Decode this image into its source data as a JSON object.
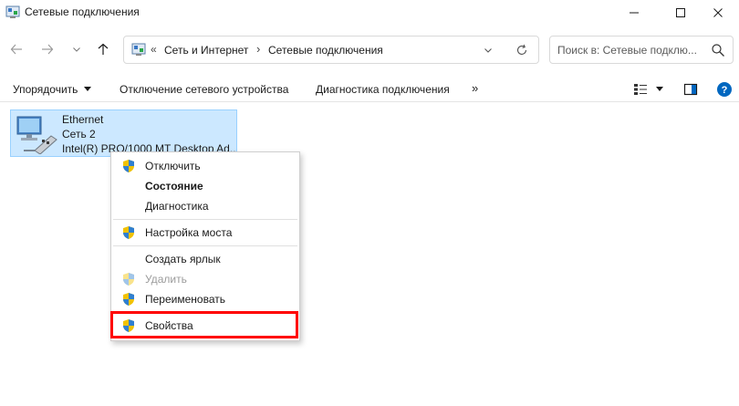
{
  "window": {
    "title": "Сетевые подключения"
  },
  "address": {
    "overflow_glyph": "«",
    "crumb_1": "Сеть и Интернет",
    "separator": "›",
    "crumb_2": "Сетевые подключения"
  },
  "search": {
    "placeholder": "Поиск в: Сетевые подклю..."
  },
  "command_bar": {
    "organize": "Упорядочить",
    "disable_device": "Отключение сетевого устройства",
    "diagnose": "Диагностика подключения",
    "more": "»"
  },
  "adapter": {
    "name": "Ethernet",
    "network": "Сеть 2",
    "device": "Intel(R) PRO/1000 MT Desktop Ad..."
  },
  "context_menu": {
    "disable": "Отключить",
    "status": "Состояние",
    "diagnose": "Диагностика",
    "bridge": "Настройка моста",
    "shortcut": "Создать ярлык",
    "delete": "Удалить",
    "rename": "Переименовать",
    "properties": "Свойства"
  },
  "colors": {
    "selection_bg": "#cce8ff",
    "highlight_box": "#ff0000",
    "accent": "#0067c0"
  },
  "icons": {
    "shield": "uac-shield-icon",
    "network_adapter": "network-adapter-icon"
  }
}
